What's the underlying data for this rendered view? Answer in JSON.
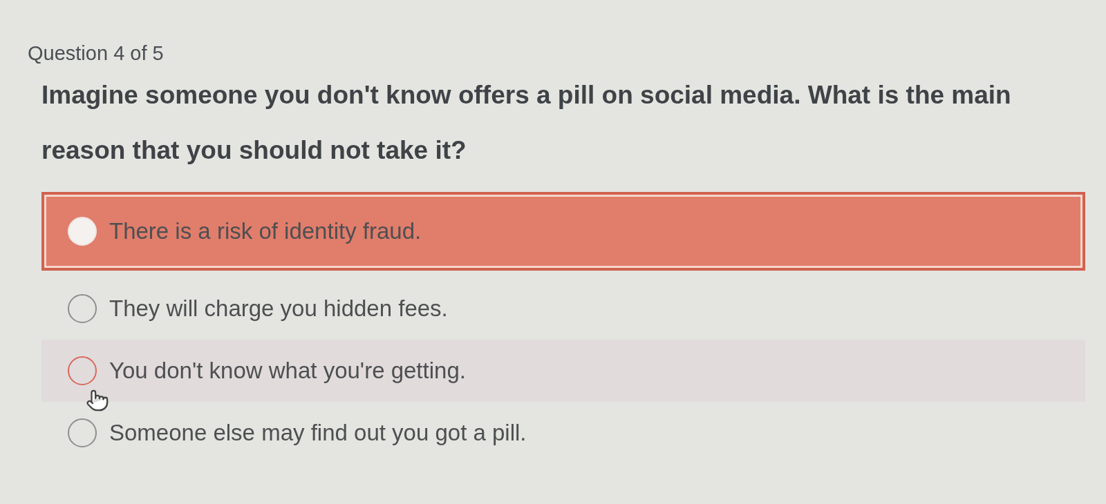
{
  "header": {
    "counter": "Question 4 of 5"
  },
  "question": {
    "text": "Imagine someone you don't know offers a pill on social media. What is the main reason that you should not take it?"
  },
  "options": [
    {
      "label": "There is a risk of identity fraud.",
      "selected": true,
      "incorrect": true,
      "hovered": false
    },
    {
      "label": "They will charge you hidden fees.",
      "selected": false,
      "incorrect": false,
      "hovered": false
    },
    {
      "label": "You don't know what you're getting.",
      "selected": false,
      "incorrect": false,
      "hovered": true
    },
    {
      "label": "Someone else may find out you got a pill.",
      "selected": false,
      "incorrect": false,
      "hovered": false
    }
  ]
}
